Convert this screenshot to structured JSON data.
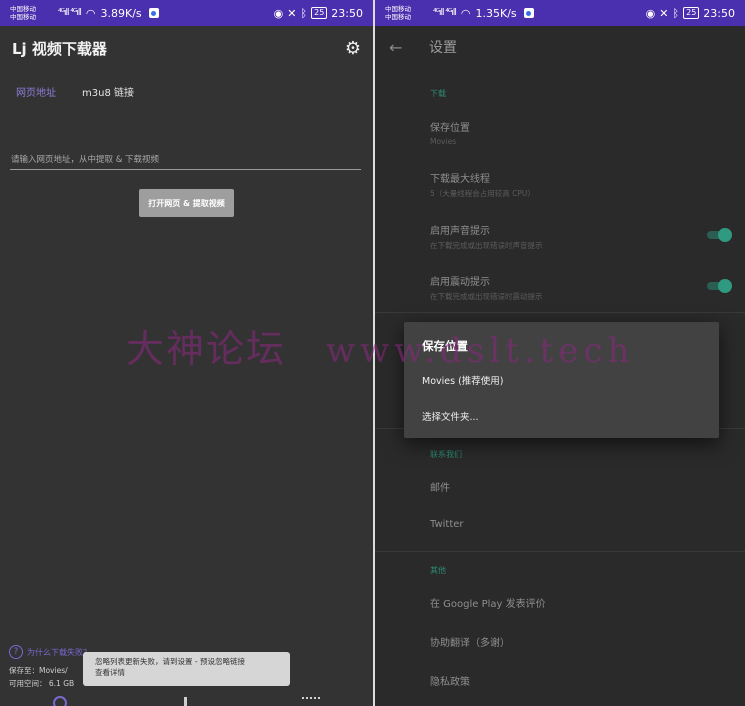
{
  "left": {
    "status": {
      "carrier1": "中国移动",
      "carrier2": "中国移动",
      "signal": "⁴ᴳıll ⁴ᴳıll",
      "speed": "3.89K/s",
      "battery": "25",
      "time": "23:50"
    },
    "app_title": "Lj 视频下载器",
    "tabs": [
      {
        "label": "网页地址",
        "active": true
      },
      {
        "label": "m3u8 链接",
        "active": false
      }
    ],
    "url_placeholder": "请输入网页地址，从中提取 & 下载视频",
    "open_button": "打开网页 & 提取视频",
    "help_link": "为什么下载失败？",
    "save_label": "保存至：Movies/",
    "free_space": "可用空间：  6.1 GB",
    "toast_line1": "忽略列表更新失败，请到设置 - 预设忽略链接",
    "toast_line2": "查看详情"
  },
  "right": {
    "status": {
      "carrier1": "中国移动",
      "carrier2": "中国移动",
      "signal": "⁴ᴳıll ⁴ᴳıll",
      "speed": "1.35K/s",
      "battery": "25",
      "time": "23:50"
    },
    "title": "设置",
    "download_header": "下载",
    "save_location_title": "保存位置",
    "save_location_value": "Movies",
    "max_threads_title": "下载最大线程",
    "max_threads_value": "5（大量线程会占用较高 CPU）",
    "sound_title": "启用声音提示",
    "sound_desc": "在下载完成或出现错误时声音提示",
    "vibrate_title": "启用震动提示",
    "vibrate_desc": "在下载完成或出现错误时震动提示",
    "contact_header": "联系我们",
    "email": "邮件",
    "twitter": "Twitter",
    "other_header": "其他",
    "rate": "在 Google Play 发表评价",
    "translate": "协助翻译（多谢）",
    "privacy": "隐私政策",
    "dialog_title": "保存位置",
    "dialog_opt1": "Movies (推荐使用)",
    "dialog_opt2": "选择文件夹..."
  },
  "watermark": {
    "text1": "大神论坛",
    "text2": "www.dslt.tech"
  },
  "colors": {
    "statusbar": "#4a2fae",
    "accent": "#7a68cf",
    "switch_on": "#2f9a7f",
    "section_header": "#2c8a74"
  }
}
